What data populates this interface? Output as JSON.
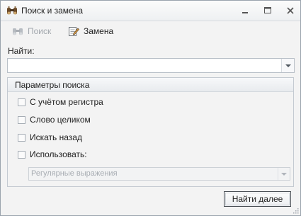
{
  "window": {
    "title": "Поиск и замена",
    "icon": "binoculars-icon",
    "controls": [
      "minimize-icon",
      "maximize-icon",
      "close-icon"
    ]
  },
  "toolbar": {
    "search_label": "Поиск",
    "replace_label": "Замена"
  },
  "find": {
    "label": "Найти:",
    "value": ""
  },
  "options": {
    "title": "Параметры поиска",
    "match_case": {
      "label": "С учётом регистра",
      "checked": false
    },
    "whole_word": {
      "label": "Слово целиком",
      "checked": false
    },
    "search_back": {
      "label": "Искать назад",
      "checked": false
    },
    "use": {
      "label": "Использовать:",
      "checked": false
    },
    "use_mode": "Регулярные выражения"
  },
  "actions": {
    "find_next_label": "Найти далее"
  },
  "colors": {
    "window_bg": "#f3f3f3",
    "border": "#9aa3ad",
    "disabled_text": "#a2a7ad"
  }
}
